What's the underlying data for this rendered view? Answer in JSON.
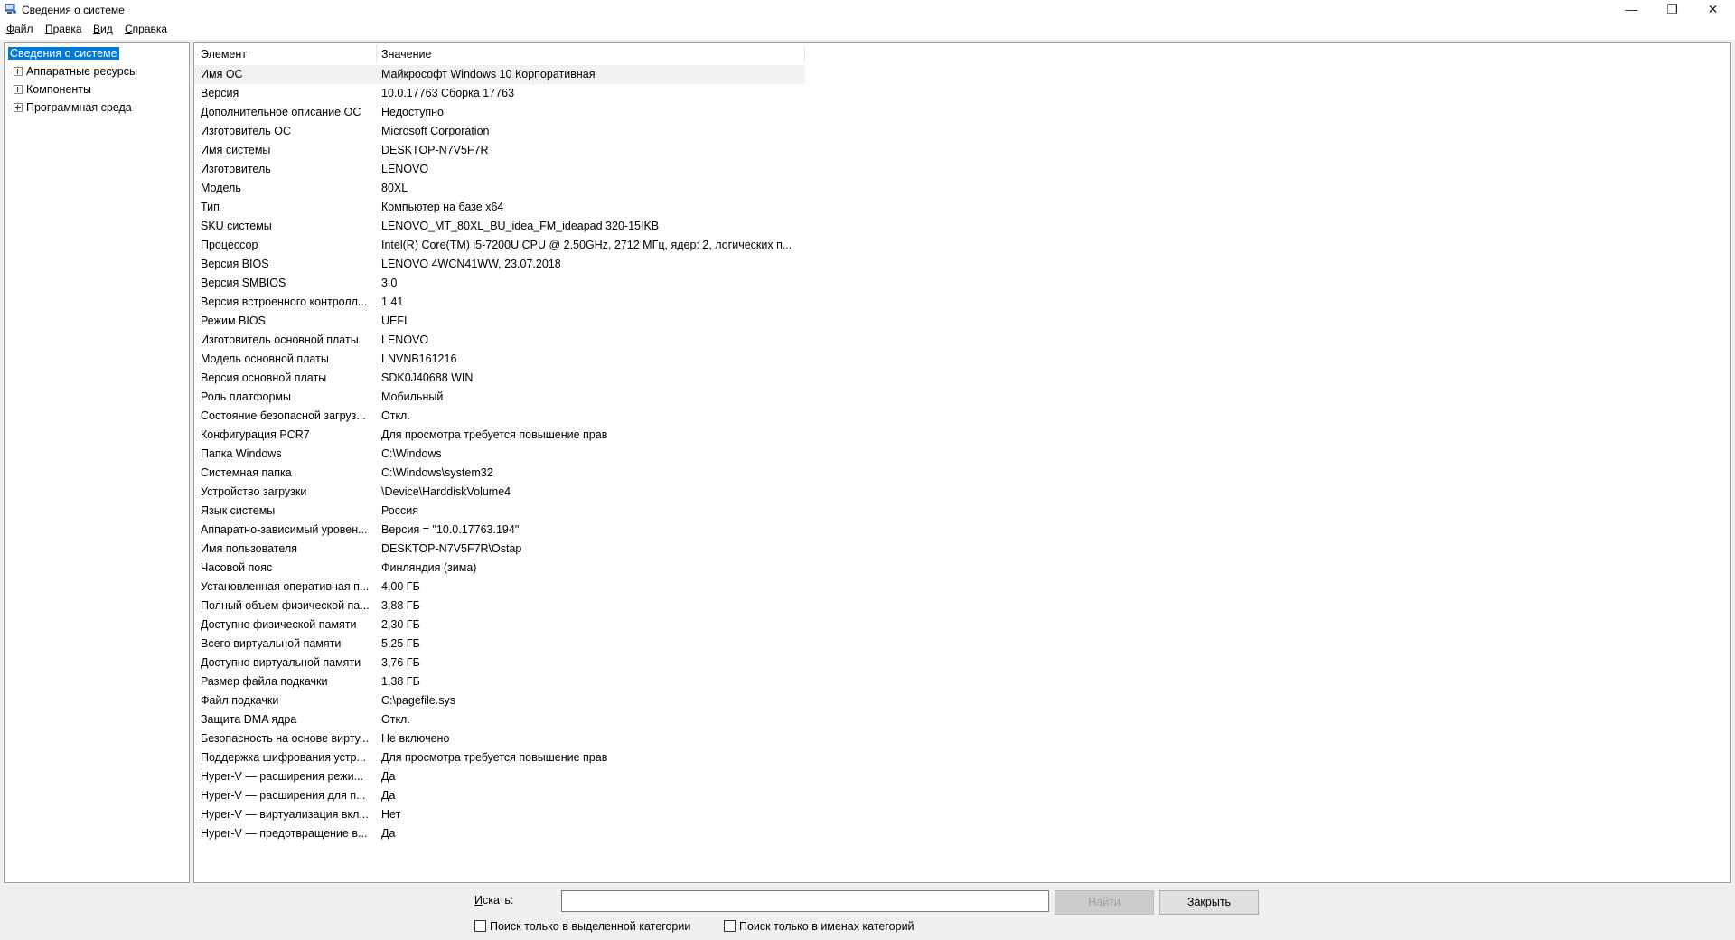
{
  "window": {
    "title": "Сведения о системе",
    "controls": {
      "minimize": "—",
      "restore": "❐",
      "close": "✕"
    }
  },
  "menu": {
    "items": [
      {
        "first": "Ф",
        "rest": "айл"
      },
      {
        "first": "П",
        "rest": "равка"
      },
      {
        "first": "В",
        "rest": "ид"
      },
      {
        "first": "С",
        "rest": "правка"
      }
    ]
  },
  "tree": {
    "items": [
      {
        "label": "Сведения о системе",
        "selected": true
      },
      {
        "label": "Аппаратные ресурсы"
      },
      {
        "label": "Компоненты"
      },
      {
        "label": "Программная среда"
      }
    ]
  },
  "list": {
    "headers": {
      "name": "Элемент",
      "value": "Значение"
    },
    "rows": [
      [
        "Имя ОС",
        "Майкрософт Windows 10 Корпоративная"
      ],
      [
        "Версия",
        "10.0.17763 Сборка 17763"
      ],
      [
        "Дополнительное описание ОС",
        "Недоступно"
      ],
      [
        "Изготовитель ОС",
        "Microsoft Corporation"
      ],
      [
        "Имя системы",
        "DESKTOP-N7V5F7R"
      ],
      [
        "Изготовитель",
        "LENOVO"
      ],
      [
        "Модель",
        "80XL"
      ],
      [
        "Тип",
        "Компьютер на базе x64"
      ],
      [
        "SKU системы",
        "LENOVO_MT_80XL_BU_idea_FM_ideapad 320-15IKB"
      ],
      [
        "Процессор",
        "Intel(R) Core(TM) i5-7200U CPU @ 2.50GHz, 2712 МГц, ядер: 2, логических п..."
      ],
      [
        "Версия BIOS",
        "LENOVO 4WCN41WW, 23.07.2018"
      ],
      [
        "Версия SMBIOS",
        "3.0"
      ],
      [
        "Версия встроенного контролл...",
        "1.41"
      ],
      [
        "Режим BIOS",
        "UEFI"
      ],
      [
        "Изготовитель основной платы",
        "LENOVO"
      ],
      [
        "Модель основной платы",
        "LNVNB161216"
      ],
      [
        "Версия основной платы",
        "SDK0J40688 WIN"
      ],
      [
        "Роль платформы",
        "Мобильный"
      ],
      [
        "Состояние безопасной загруз...",
        "Откл."
      ],
      [
        "Конфигурация PCR7",
        "Для просмотра требуется повышение прав"
      ],
      [
        "Папка Windows",
        "C:\\Windows"
      ],
      [
        "Системная папка",
        "C:\\Windows\\system32"
      ],
      [
        "Устройство загрузки",
        "\\Device\\HarddiskVolume4"
      ],
      [
        "Язык системы",
        "Россия"
      ],
      [
        "Аппаратно-зависимый уровен...",
        "Версия = \"10.0.17763.194\""
      ],
      [
        "Имя пользователя",
        "DESKTOP-N7V5F7R\\Ostap"
      ],
      [
        "Часовой пояс",
        "Финляндия (зима)"
      ],
      [
        "Установленная оперативная п...",
        "4,00 ГБ"
      ],
      [
        "Полный объем физической па...",
        "3,88 ГБ"
      ],
      [
        "Доступно физической памяти",
        "2,30 ГБ"
      ],
      [
        "Всего виртуальной памяти",
        "5,25 ГБ"
      ],
      [
        "Доступно виртуальной памяти",
        "3,76 ГБ"
      ],
      [
        "Размер файла подкачки",
        "1,38 ГБ"
      ],
      [
        "Файл подкачки",
        "C:\\pagefile.sys"
      ],
      [
        "Защита DMA ядра",
        "Откл."
      ],
      [
        "Безопасность на основе вирту...",
        "Не включено"
      ],
      [
        "Поддержка шифрования устр...",
        "Для просмотра требуется повышение прав"
      ],
      [
        "Hyper-V — расширения режи...",
        "Да"
      ],
      [
        "Hyper-V — расширения для п...",
        "Да"
      ],
      [
        "Hyper-V — виртуализация вкл...",
        "Нет"
      ],
      [
        "Hyper-V — предотвращение в...",
        "Да"
      ]
    ]
  },
  "search": {
    "label_first": "И",
    "label_rest": "скать:",
    "value": "",
    "find_button": "Найти",
    "close_first": "З",
    "close_rest": "акрыть",
    "checkbox_selected_category": "Поиск только в выделенной категории",
    "checkbox_category_names": "Поиск только в именах категорий"
  },
  "colors": {
    "selection": "#0078d7",
    "background": "#f0f0f0"
  }
}
